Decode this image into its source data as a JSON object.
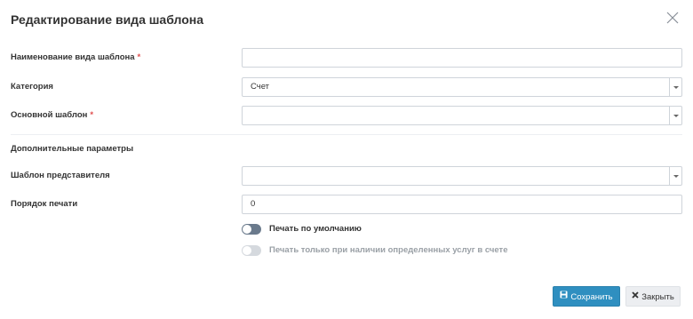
{
  "dialog": {
    "title": "Редактирование вида шаблона"
  },
  "fields": {
    "template_type_name": {
      "label": "Наименование вида шаблона",
      "required_mark": "*",
      "value": ""
    },
    "category": {
      "label": "Категория",
      "value": "Счет"
    },
    "main_template": {
      "label": "Основной шаблон",
      "required_mark": "*",
      "value": ""
    }
  },
  "additional": {
    "section_title": "Дополнительные параметры",
    "representative_template": {
      "label": "Шаблон представителя",
      "value": ""
    },
    "print_order": {
      "label": "Порядок печати",
      "value": "0"
    },
    "print_default": {
      "label": "Печать по умолчанию",
      "enabled": false
    },
    "print_only_services": {
      "label": "Печать только при наличии определенных услуг в счете",
      "enabled": false,
      "disabled": true
    }
  },
  "footer": {
    "save_label": "Сохранить",
    "close_label": "Закрыть"
  },
  "colors": {
    "primary": "#2f8fc0",
    "required": "#e05050",
    "toggle_off": "#6a7a8c"
  }
}
